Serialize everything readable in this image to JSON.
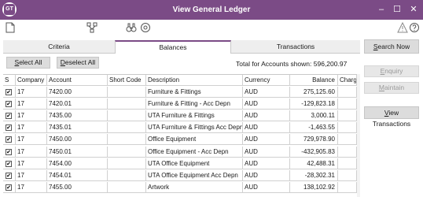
{
  "window": {
    "title": "View General Ledger",
    "logo": "GT",
    "minimize": "–",
    "maximize": "☐",
    "close": "✕"
  },
  "toolbar": {
    "icons": [
      "document-icon",
      "hierarchy-icon",
      "binoculars-icon",
      "settings-circle-icon",
      "warning-icon",
      "help-icon"
    ]
  },
  "tabs": [
    {
      "label": "Criteria",
      "active": false
    },
    {
      "label": "Balances",
      "active": true
    },
    {
      "label": "Transactions",
      "active": false
    }
  ],
  "buttons": {
    "select_all_u": "S",
    "select_all_rest": "elect All",
    "deselect_all_u": "D",
    "deselect_all_rest": "eselect All",
    "search_now_u": "S",
    "search_now_rest": "earch Now",
    "enquiry_u": "E",
    "enquiry_rest": "nquiry",
    "maintain_u": "M",
    "maintain_rest": "aintain",
    "view_transactions_u": "V",
    "view_transactions_rest": "iew Transactions"
  },
  "summary": {
    "total_label": "Total for Accounts shown:",
    "total_value": "596,200.97"
  },
  "table": {
    "headers": [
      "S",
      "Company",
      "Account",
      "Short Code",
      "Description",
      "Currency",
      "Balance",
      "Charg"
    ],
    "rows": [
      {
        "checked": "✔",
        "company": "17",
        "account": "7420.00",
        "short_code": "",
        "description": "Furniture & Fittings",
        "currency": "AUD",
        "balance": "275,125.60"
      },
      {
        "checked": "✔",
        "company": "17",
        "account": "7420.01",
        "short_code": "",
        "description": "Furniture & Fitting - Acc Depn",
        "currency": "AUD",
        "balance": "-129,823.18"
      },
      {
        "checked": "✔",
        "company": "17",
        "account": "7435.00",
        "short_code": "",
        "description": "UTA Furniture & Fittings",
        "currency": "AUD",
        "balance": "3,000.11"
      },
      {
        "checked": "✔",
        "company": "17",
        "account": "7435.01",
        "short_code": "",
        "description": "UTA Furniture & Fittings Acc Depn",
        "currency": "AUD",
        "balance": "-1,463.55"
      },
      {
        "checked": "✔",
        "company": "17",
        "account": "7450.00",
        "short_code": "",
        "description": "Office Equipment",
        "currency": "AUD",
        "balance": "729,978.90"
      },
      {
        "checked": "✔",
        "company": "17",
        "account": "7450.01",
        "short_code": "",
        "description": "Office Equipment - Acc Depn",
        "currency": "AUD",
        "balance": "-432,905.83"
      },
      {
        "checked": "✔",
        "company": "17",
        "account": "7454.00",
        "short_code": "",
        "description": "UTA Office Equipment",
        "currency": "AUD",
        "balance": "42,488.31"
      },
      {
        "checked": "✔",
        "company": "17",
        "account": "7454.01",
        "short_code": "",
        "description": "UTA Office Equipment Acc Depn",
        "currency": "AUD",
        "balance": "-28,302.31"
      },
      {
        "checked": "✔",
        "company": "17",
        "account": "7455.00",
        "short_code": "",
        "description": "Artwork",
        "currency": "AUD",
        "balance": "138,102.92"
      }
    ]
  },
  "colors": {
    "titlebar": "#7b4b86",
    "accent": "#7b4b86"
  }
}
